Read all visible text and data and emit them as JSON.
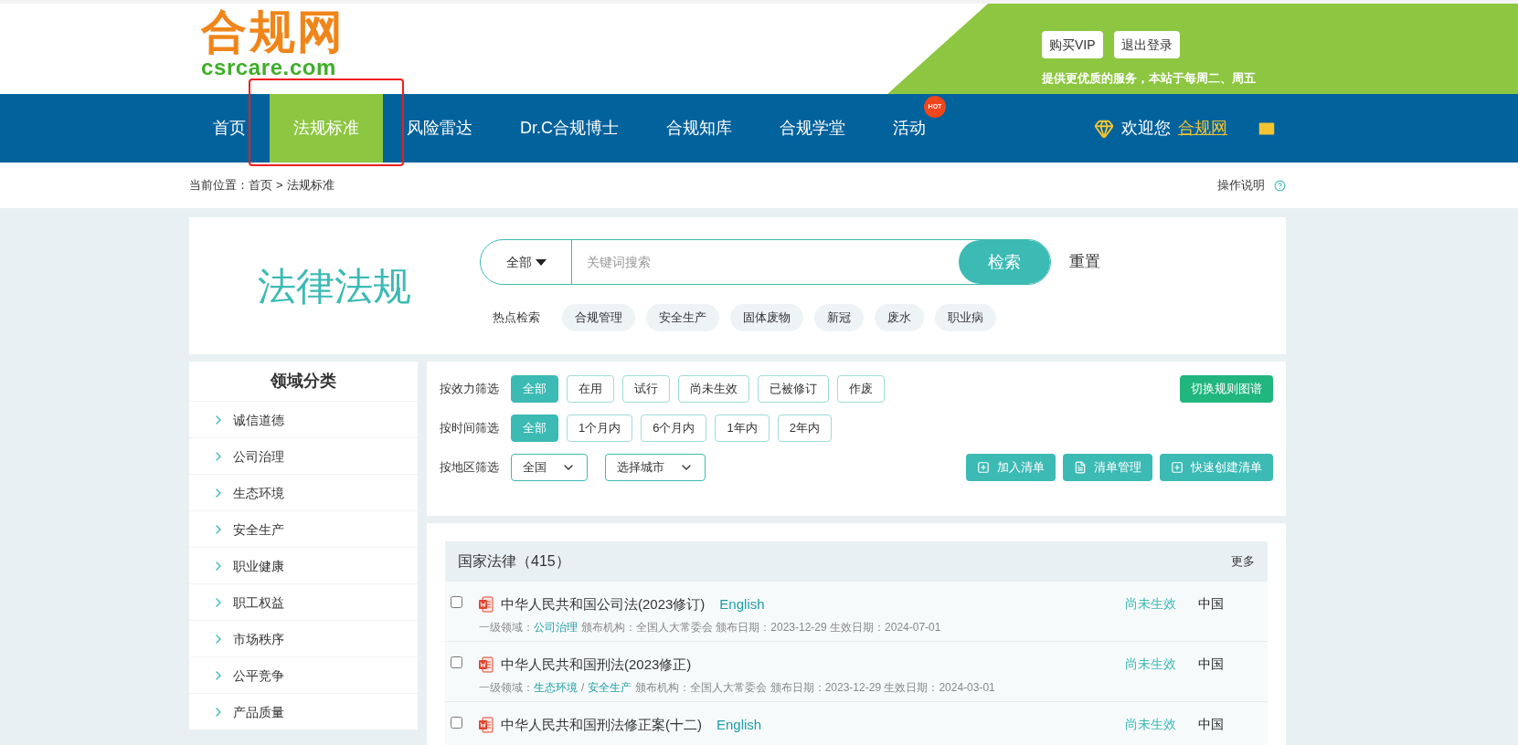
{
  "header": {
    "logo_title": "合规网",
    "logo_domain": "csrcare.com",
    "buttons": [
      "购买VIP",
      "退出登录"
    ],
    "notice": "提供更优质的服务，本站于每周二、周五"
  },
  "nav": {
    "items": [
      {
        "label": "首页",
        "selected": false
      },
      {
        "label": "法规标准",
        "selected": true
      },
      {
        "label": "风险雷达",
        "selected": false
      },
      {
        "label": "Dr.C合规博士",
        "selected": false
      },
      {
        "label": "合规知库",
        "selected": false
      },
      {
        "label": "合规学堂",
        "selected": false
      },
      {
        "label": "活动",
        "selected": false,
        "badge": "HOT"
      }
    ],
    "welcome": "欢迎您",
    "user": "合规网"
  },
  "breadcrumb": {
    "label": "当前位置：",
    "items": [
      "首页",
      "法规标准"
    ],
    "separator": ">",
    "help": "操作说明"
  },
  "search": {
    "title": "法律法规",
    "scope": "全部",
    "placeholder": "关键词搜索",
    "button": "检索",
    "reset": "重置",
    "hot_label": "热点检索",
    "hot_tags": [
      "合规管理",
      "安全生产",
      "固体废物",
      "新冠",
      "废水",
      "职业病"
    ]
  },
  "sidebar": {
    "title": "领域分类",
    "items": [
      "诚信道德",
      "公司治理",
      "生态环境",
      "安全生产",
      "职业健康",
      "职工权益",
      "市场秩序",
      "公平竞争",
      "产品质量"
    ]
  },
  "filters": {
    "rows": [
      {
        "label": "按效力筛选",
        "options": [
          {
            "label": "全部",
            "selected": true
          },
          {
            "label": "在用",
            "selected": false
          },
          {
            "label": "试行",
            "selected": false
          },
          {
            "label": "尚未生效",
            "selected": false
          },
          {
            "label": "已被修订",
            "selected": false
          },
          {
            "label": "作废",
            "selected": false
          }
        ]
      },
      {
        "label": "按时间筛选",
        "options": [
          {
            "label": "全部",
            "selected": true
          },
          {
            "label": "1个月内",
            "selected": false
          },
          {
            "label": "6个月内",
            "selected": false
          },
          {
            "label": "1年内",
            "selected": false
          },
          {
            "label": "2年内",
            "selected": false
          }
        ]
      }
    ],
    "switch_button": "切换规则图谱",
    "region_label": "按地区筛选",
    "selects": [
      "全国",
      "选择城市"
    ],
    "actions": [
      {
        "label": "加入清单",
        "kind": "add"
      },
      {
        "label": "清单管理",
        "kind": "doc"
      },
      {
        "label": "快速创建清单",
        "kind": "add"
      }
    ]
  },
  "list": {
    "title": "国家法律（415）",
    "more": "更多",
    "rows": [
      {
        "checked": false,
        "title": "中华人民共和国公司法(2023修订)",
        "english": "English",
        "domain_label": "一级领域：",
        "domains": [
          "公司治理"
        ],
        "details": "颁布机构：全国人大常委会 颁布日期：2023-12-29 生效日期：2024-07-01",
        "status": "尚未生效",
        "region": "中国"
      },
      {
        "checked": false,
        "title": "中华人民共和国刑法(2023修正)",
        "domain_label": "一级领域：",
        "domains": [
          "生态环境",
          "安全生产"
        ],
        "details": "颁布机构：全国人大常委会 颁布日期：2023-12-29 生效日期：2024-03-01",
        "status": "尚未生效",
        "region": "中国"
      },
      {
        "checked": false,
        "title": "中华人民共和国刑法修正案(十二)",
        "english": "English",
        "status": "尚未生效",
        "region": "中国"
      }
    ],
    "domain_separator": "/"
  }
}
